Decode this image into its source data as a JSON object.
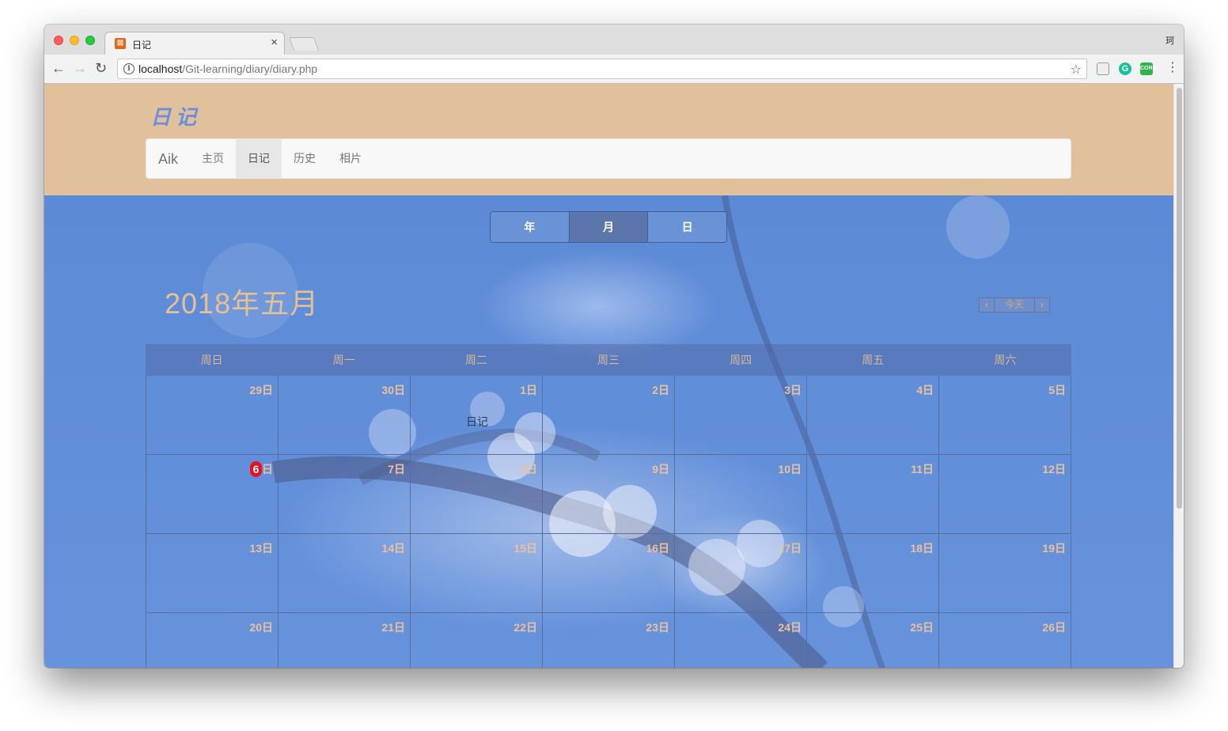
{
  "browser": {
    "tab_title": "日记",
    "tab_favicon": "xampp-favicon-icon",
    "close_symbol": "×",
    "profile_name": "珂",
    "url_host": "localhost",
    "url_path": "/Git-learning/diary/diary.php",
    "extensions": [
      "shield-extension-icon",
      "grammarly-icon",
      "cors-icon"
    ]
  },
  "header": {
    "site_title": "日记",
    "nav": {
      "brand": "Aik",
      "items": [
        {
          "label": "主页",
          "active": false
        },
        {
          "label": "日记",
          "active": true
        },
        {
          "label": "历史",
          "active": false
        },
        {
          "label": "相片",
          "active": false
        }
      ]
    }
  },
  "calendar": {
    "views": [
      {
        "label": "年",
        "active": false
      },
      {
        "label": "月",
        "active": true
      },
      {
        "label": "日",
        "active": false
      }
    ],
    "title": "2018年五月",
    "today_button": "今天",
    "weekdays": [
      "周日",
      "周一",
      "周二",
      "周三",
      "周四",
      "周五",
      "周六"
    ],
    "weeks": [
      [
        {
          "date": "29"
        },
        {
          "date": "30"
        },
        {
          "date": "1",
          "event": "日记"
        },
        {
          "date": "2"
        },
        {
          "date": "3"
        },
        {
          "date": "4"
        },
        {
          "date": "5"
        }
      ],
      [
        {
          "date": "6",
          "today": true
        },
        {
          "date": "7"
        },
        {
          "date": "8"
        },
        {
          "date": "9"
        },
        {
          "date": "10"
        },
        {
          "date": "11"
        },
        {
          "date": "12"
        }
      ],
      [
        {
          "date": "13"
        },
        {
          "date": "14"
        },
        {
          "date": "15"
        },
        {
          "date": "16"
        },
        {
          "date": "17"
        },
        {
          "date": "18"
        },
        {
          "date": "19"
        }
      ],
      [
        {
          "date": "20"
        },
        {
          "date": "21"
        },
        {
          "date": "22"
        },
        {
          "date": "23"
        },
        {
          "date": "24"
        },
        {
          "date": "25"
        },
        {
          "date": "26"
        }
      ]
    ],
    "day_suffix": "日"
  },
  "colors": {
    "header_bg": "#e0c19c",
    "title_color": "#6b8fde",
    "main_bg": "#6793dc",
    "date_text": "#ebc19e",
    "today_badge": "#e8101a"
  }
}
